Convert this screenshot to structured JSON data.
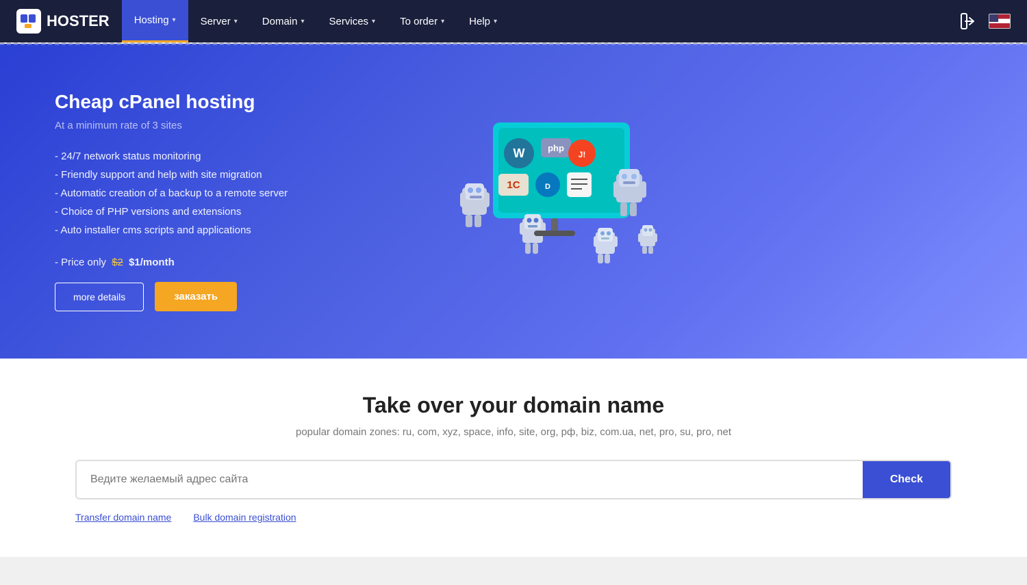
{
  "logo": {
    "text": "HOSTER"
  },
  "nav": {
    "items": [
      {
        "label": "Hosting",
        "active": true,
        "has_dropdown": true
      },
      {
        "label": "Server",
        "active": false,
        "has_dropdown": true
      },
      {
        "label": "Domain",
        "active": false,
        "has_dropdown": true
      },
      {
        "label": "Services",
        "active": false,
        "has_dropdown": true
      },
      {
        "label": "To order",
        "active": false,
        "has_dropdown": true
      },
      {
        "label": "Help",
        "active": false,
        "has_dropdown": true
      }
    ],
    "login_icon": "→",
    "flag_alt": "English"
  },
  "hero": {
    "title": "Cheap cPanel hosting",
    "subtitle": "At a minimum rate of 3 sites",
    "features": [
      "- 24/7 network status monitoring",
      "- Friendly support and help with site migration",
      "- Automatic creation of a backup to a remote server",
      "- Choice of PHP versions and extensions",
      "- Auto installer cms scripts and applications"
    ],
    "price_label": "- Price only",
    "old_price": "$2",
    "new_price": "$1/month",
    "btn_details": "more details",
    "btn_order": "заказать"
  },
  "domain": {
    "title": "Take over your domain name",
    "subtitle": "popular domain zones: ru, com, xyz, space, info, site, org, рф, biz, com.ua, net, pro, su, pro, net",
    "input_placeholder": "Ведите желаемый адрес сайта",
    "check_button": "Check",
    "links": [
      "Transfer domain name",
      "Bulk domain registration"
    ]
  }
}
